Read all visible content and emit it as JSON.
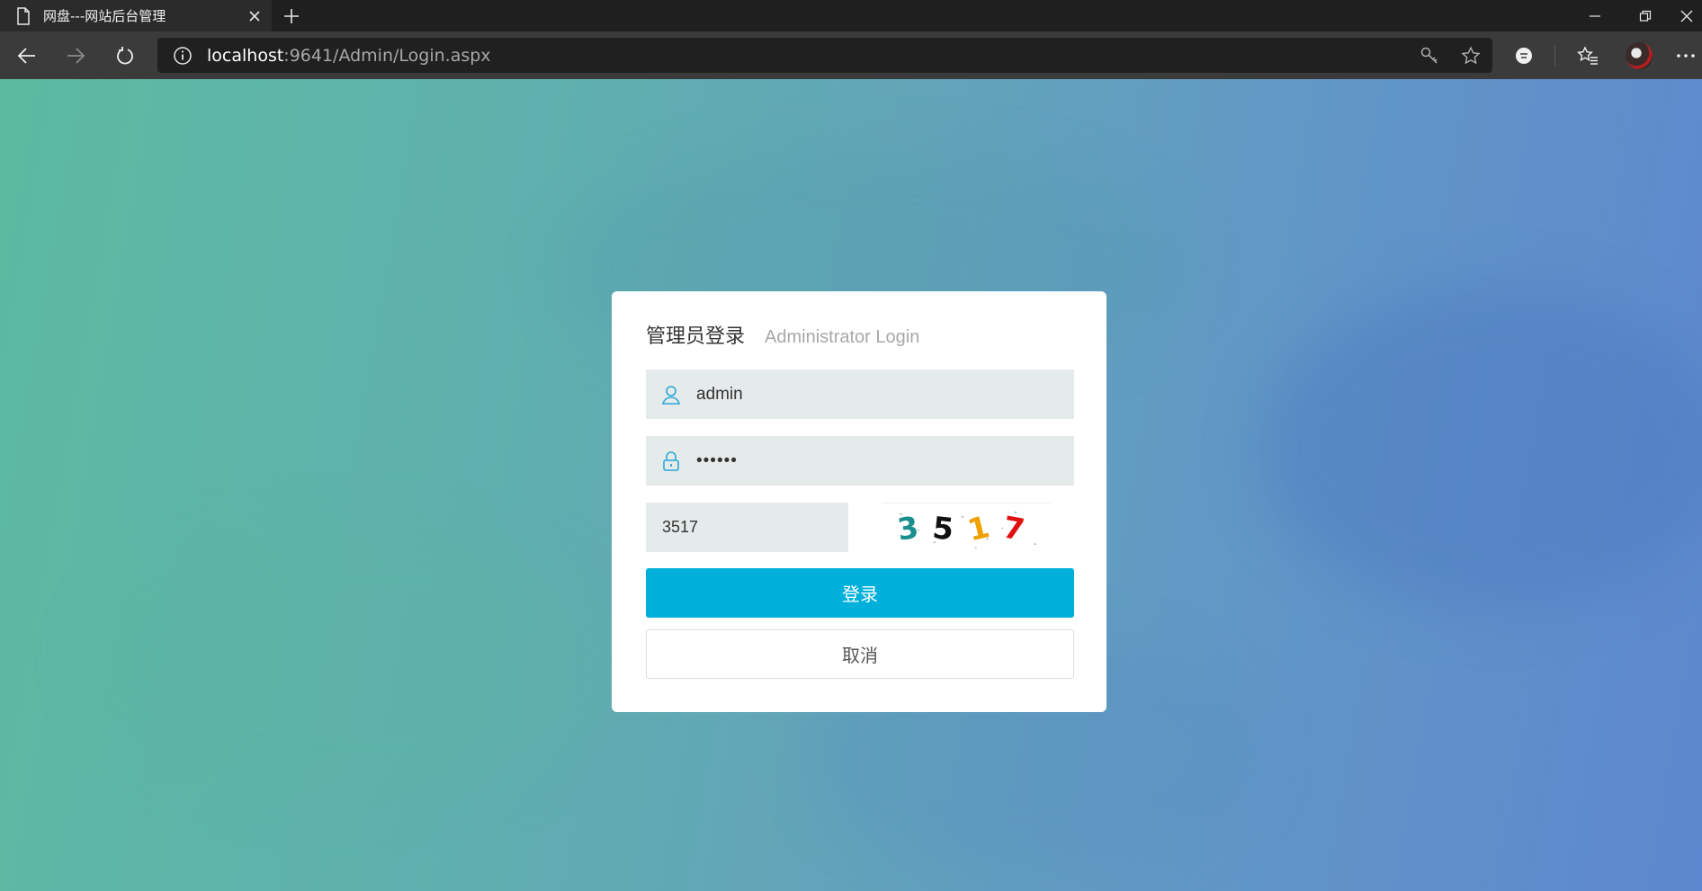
{
  "browser": {
    "tab_title": "网盘---网站后台管理",
    "url_host": "localhost",
    "url_path": ":9641/Admin/Login.aspx",
    "icons": {
      "tab": "page-icon",
      "close": "close-icon",
      "new_tab": "plus-icon",
      "back": "arrow-left-icon",
      "forward": "arrow-right-icon",
      "refresh": "refresh-icon",
      "site_info": "info-icon",
      "key": "key-icon",
      "favorite": "star-icon",
      "extension": "extension-icon",
      "favorites": "favorites-icon",
      "profile": "avatar",
      "more": "more-icon"
    }
  },
  "login": {
    "title": "管理员登录",
    "subtitle": "Administrator Login",
    "username": "admin",
    "password": "••••••",
    "captcha_input": "3517",
    "captcha_digits": [
      "3",
      "5",
      "1",
      "7"
    ],
    "captcha_colors": [
      "#1a8f8f",
      "#111111",
      "#f0a000",
      "#e01010"
    ],
    "login_label": "登录",
    "cancel_label": "取消"
  },
  "colors": {
    "accent": "#00b0db",
    "card": "#ffffff",
    "field": "#e5eaea",
    "icon": "#2aa8d8"
  }
}
